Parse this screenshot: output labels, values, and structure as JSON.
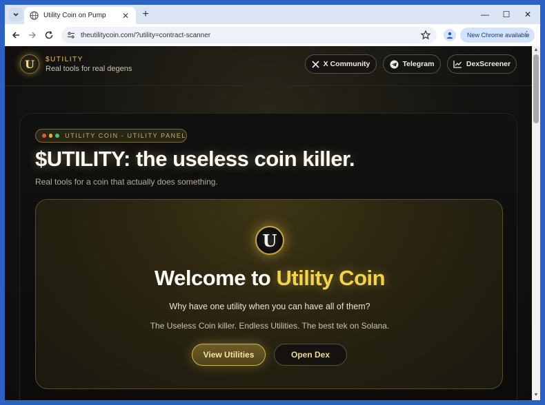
{
  "browser": {
    "tab_title": "Utility Coin on Pump",
    "url": "theutilitycoin.com/?utility=contract-scanner",
    "update_chip": "New Chrome available"
  },
  "site": {
    "brand_name": "$UTILITY",
    "brand_tagline": "Real tools for real degens",
    "nav": {
      "x_community": "X Community",
      "telegram": "Telegram",
      "dexscreener": "DexScreener"
    }
  },
  "panel": {
    "pill_label": "UTILITY COIN - UTILITY PANEL",
    "pill_dot_colors": [
      "#e2574c",
      "#e8b33c",
      "#4cc16a"
    ],
    "title": "$UTILITY: the useless coin killer.",
    "subtitle": "Real tools for a coin that actually does something."
  },
  "card": {
    "logo_letter": "U",
    "welcome_prefix": "Welcome to ",
    "welcome_accent": "Utility Coin",
    "tagline": "Why have one utility when you can have all of them?",
    "description": "The Useless Coin killer. Endless Utilities. The best tek on Solana.",
    "primary_button": "View Utilities",
    "secondary_button": "Open Dex"
  },
  "colors": {
    "accent_gold": "#f3d24c",
    "page_bg": "#141311",
    "chrome_frame": "#2d62c4"
  }
}
